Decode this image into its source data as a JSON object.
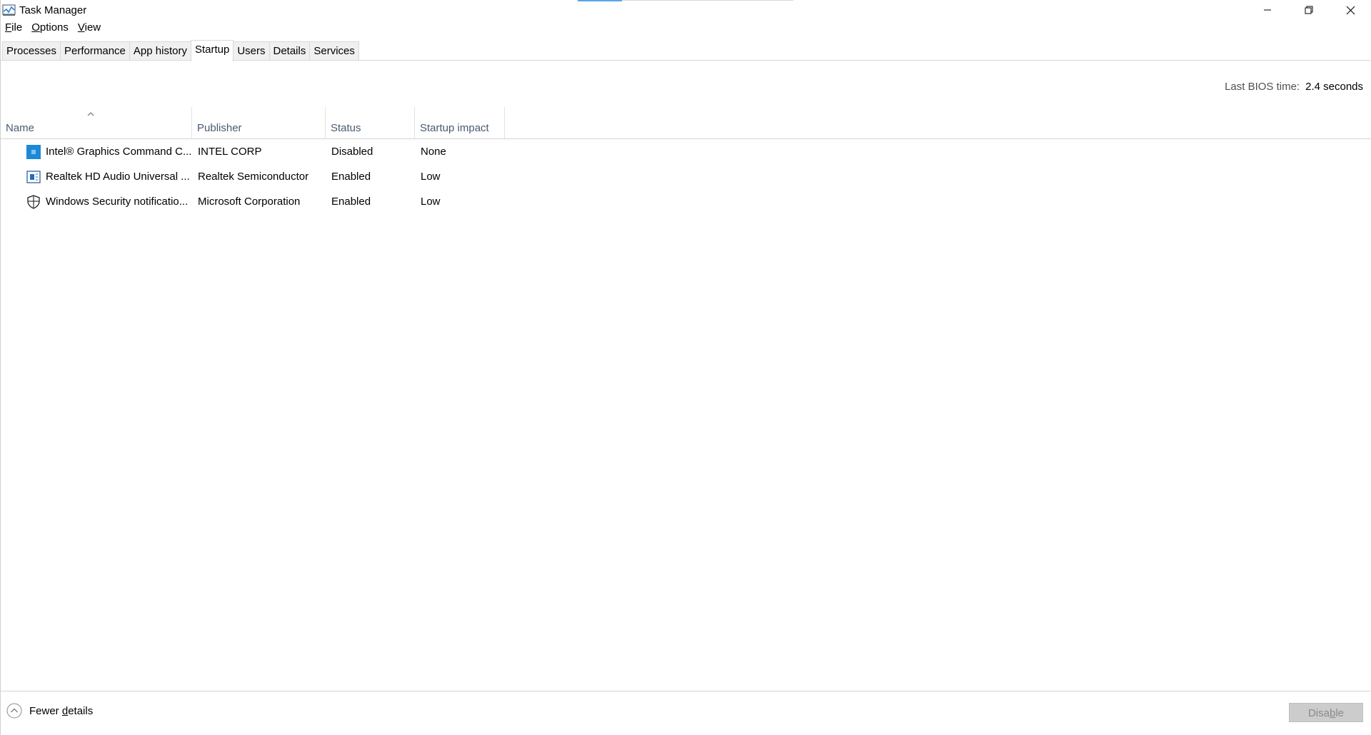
{
  "window": {
    "title": "Task Manager",
    "app_icon": "task-manager-icon",
    "accent_color": "#5aa5e6"
  },
  "menu": {
    "file": {
      "pre": "",
      "acc": "F",
      "post": "ile"
    },
    "options": {
      "pre": "",
      "acc": "O",
      "post": "ptions"
    },
    "view": {
      "pre": "",
      "acc": "V",
      "post": "iew"
    }
  },
  "tabs": [
    {
      "label": "Processes"
    },
    {
      "label": "Performance"
    },
    {
      "label": "App history"
    },
    {
      "label": "Startup"
    },
    {
      "label": "Users"
    },
    {
      "label": "Details"
    },
    {
      "label": "Services"
    }
  ],
  "active_tab": "Startup",
  "bios": {
    "label": "Last BIOS time:",
    "value": "2.4 seconds"
  },
  "columns": {
    "name": "Name",
    "publisher": "Publisher",
    "status": "Status",
    "impact": "Startup impact"
  },
  "rows": [
    {
      "name": "Intel® Graphics Command C...",
      "publisher": "INTEL CORP",
      "status": "Disabled",
      "impact": "None",
      "icon": "intel-graphics-icon"
    },
    {
      "name": "Realtek HD Audio Universal ...",
      "publisher": "Realtek Semiconductor",
      "status": "Enabled",
      "impact": "Low",
      "icon": "realtek-audio-icon"
    },
    {
      "name": "Windows Security notificatio...",
      "publisher": "Microsoft Corporation",
      "status": "Enabled",
      "impact": "Low",
      "icon": "shield-icon"
    }
  ],
  "footer": {
    "fewer_pre": "Fewer ",
    "fewer_acc": "d",
    "fewer_post": "etails",
    "disable_pre": "Disa",
    "disable_acc": "b",
    "disable_post": "le"
  }
}
